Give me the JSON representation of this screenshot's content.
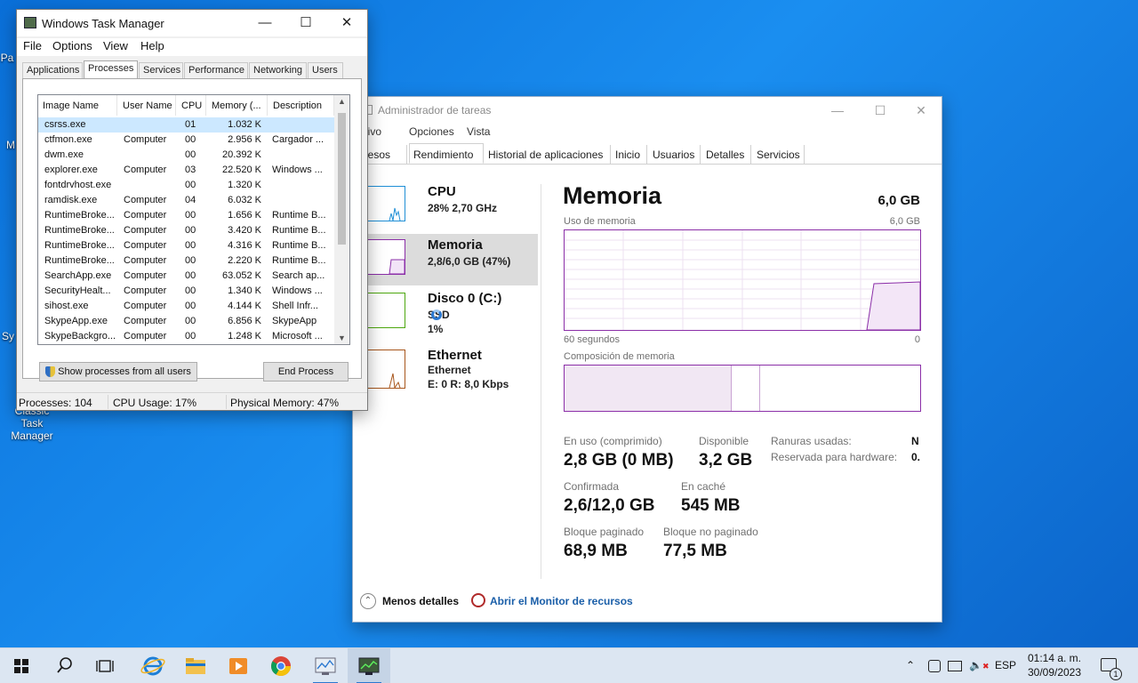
{
  "desktop": {
    "icons": [
      {
        "label": "Pa"
      },
      {
        "label": "M"
      },
      {
        "label": "Sy"
      },
      {
        "label": "Classic Task Manager"
      }
    ]
  },
  "modern_tm": {
    "title": "Administrador de tareas",
    "menu": [
      "rchivo",
      "Opciones",
      "Vista"
    ],
    "tabs": [
      "ocesos",
      "Rendimiento",
      "Historial de aplicaciones",
      "Inicio",
      "Usuarios",
      "Detalles",
      "Servicios"
    ],
    "active_tab": "Rendimiento",
    "sidebar": [
      {
        "title": "CPU",
        "sub": "28%  2,70 GHz",
        "sub2": ""
      },
      {
        "title": "Memoria",
        "sub": "2,8/6,0 GB (47%)",
        "sub2": ""
      },
      {
        "title": "Disco 0 (C:)",
        "sub": "SSD",
        "sub2": "1%"
      },
      {
        "title": "Ethernet",
        "sub": "Ethernet",
        "sub2": "E: 0  R: 8,0 Kbps"
      }
    ],
    "main": {
      "title": "Memoria",
      "total": "6,0 GB",
      "usage_label": "Uso de memoria",
      "usage_max": "6,0 GB",
      "time_left": "60 segundos",
      "time_right": "0",
      "composition_label": "Composición de memoria",
      "stats": {
        "in_use_label": "En uso (comprimido)",
        "in_use_value": "2,8 GB (0 MB)",
        "available_label": "Disponible",
        "available_value": "3,2 GB",
        "committed_label": "Confirmada",
        "committed_value": "2,6/12,0 GB",
        "cached_label": "En caché",
        "cached_value": "545 MB",
        "paged_label": "Bloque paginado",
        "paged_value": "68,9 MB",
        "nonpaged_label": "Bloque no paginado",
        "nonpaged_value": "77,5 MB"
      },
      "slots_label": "Ranuras usadas:",
      "slots_value": "N",
      "reserved_label": "Reservada para hardware:",
      "reserved_value": "0."
    },
    "footer": {
      "less_details": "Menos detalles",
      "resource_monitor": "Abrir el Monitor de recursos"
    },
    "colors": {
      "memory": "#8b2fa8",
      "cpu": "#1f8fd6",
      "disk": "#4da70f",
      "ethernet": "#a7551b",
      "link": "#1a5ea8"
    }
  },
  "classic_tm": {
    "title": "Windows Task Manager",
    "menu": [
      "File",
      "Options",
      "View",
      "Help"
    ],
    "tabs": [
      "Applications",
      "Processes",
      "Services",
      "Performance",
      "Networking",
      "Users"
    ],
    "active_tab": "Processes",
    "columns": [
      "Image Name",
      "User Name",
      "CPU",
      "Memory (...",
      "Description"
    ],
    "rows": [
      {
        "name": "csrss.exe",
        "user": "",
        "cpu": "01",
        "mem": "1.032 K",
        "desc": ""
      },
      {
        "name": "ctfmon.exe",
        "user": "Computer",
        "cpu": "00",
        "mem": "2.956 K",
        "desc": "Cargador ..."
      },
      {
        "name": "dwm.exe",
        "user": "",
        "cpu": "00",
        "mem": "20.392 K",
        "desc": ""
      },
      {
        "name": "explorer.exe",
        "user": "Computer",
        "cpu": "03",
        "mem": "22.520 K",
        "desc": "Windows ..."
      },
      {
        "name": "fontdrvhost.exe",
        "user": "",
        "cpu": "00",
        "mem": "1.320 K",
        "desc": ""
      },
      {
        "name": "ramdisk.exe",
        "user": "Computer",
        "cpu": "04",
        "mem": "6.032 K",
        "desc": ""
      },
      {
        "name": "RuntimeBroke...",
        "user": "Computer",
        "cpu": "00",
        "mem": "1.656 K",
        "desc": "Runtime B..."
      },
      {
        "name": "RuntimeBroke...",
        "user": "Computer",
        "cpu": "00",
        "mem": "3.420 K",
        "desc": "Runtime B..."
      },
      {
        "name": "RuntimeBroke...",
        "user": "Computer",
        "cpu": "00",
        "mem": "4.316 K",
        "desc": "Runtime B..."
      },
      {
        "name": "RuntimeBroke...",
        "user": "Computer",
        "cpu": "00",
        "mem": "2.220 K",
        "desc": "Runtime B..."
      },
      {
        "name": "SearchApp.exe",
        "user": "Computer",
        "cpu": "00",
        "mem": "63.052 K",
        "desc": "Search ap..."
      },
      {
        "name": "SecurityHealt...",
        "user": "Computer",
        "cpu": "00",
        "mem": "1.340 K",
        "desc": "Windows ..."
      },
      {
        "name": "sihost.exe",
        "user": "Computer",
        "cpu": "00",
        "mem": "4.144 K",
        "desc": "Shell Infr..."
      },
      {
        "name": "SkypeApp.exe",
        "user": "Computer",
        "cpu": "00",
        "mem": "6.856 K",
        "desc": "SkypeApp"
      },
      {
        "name": "SkypeBackgro...",
        "user": "Computer",
        "cpu": "00",
        "mem": "1.248 K",
        "desc": "Microsoft ..."
      }
    ],
    "show_all_button": "Show processes from all users",
    "end_process_button": "End Process",
    "status": {
      "processes": "Processes: 104",
      "cpu": "CPU Usage: 17%",
      "memory": "Physical Memory: 47%"
    }
  },
  "taskbar": {
    "language": "ESP",
    "time": "01:14 a. m.",
    "date": "30/09/2023",
    "notification_count": "1"
  }
}
